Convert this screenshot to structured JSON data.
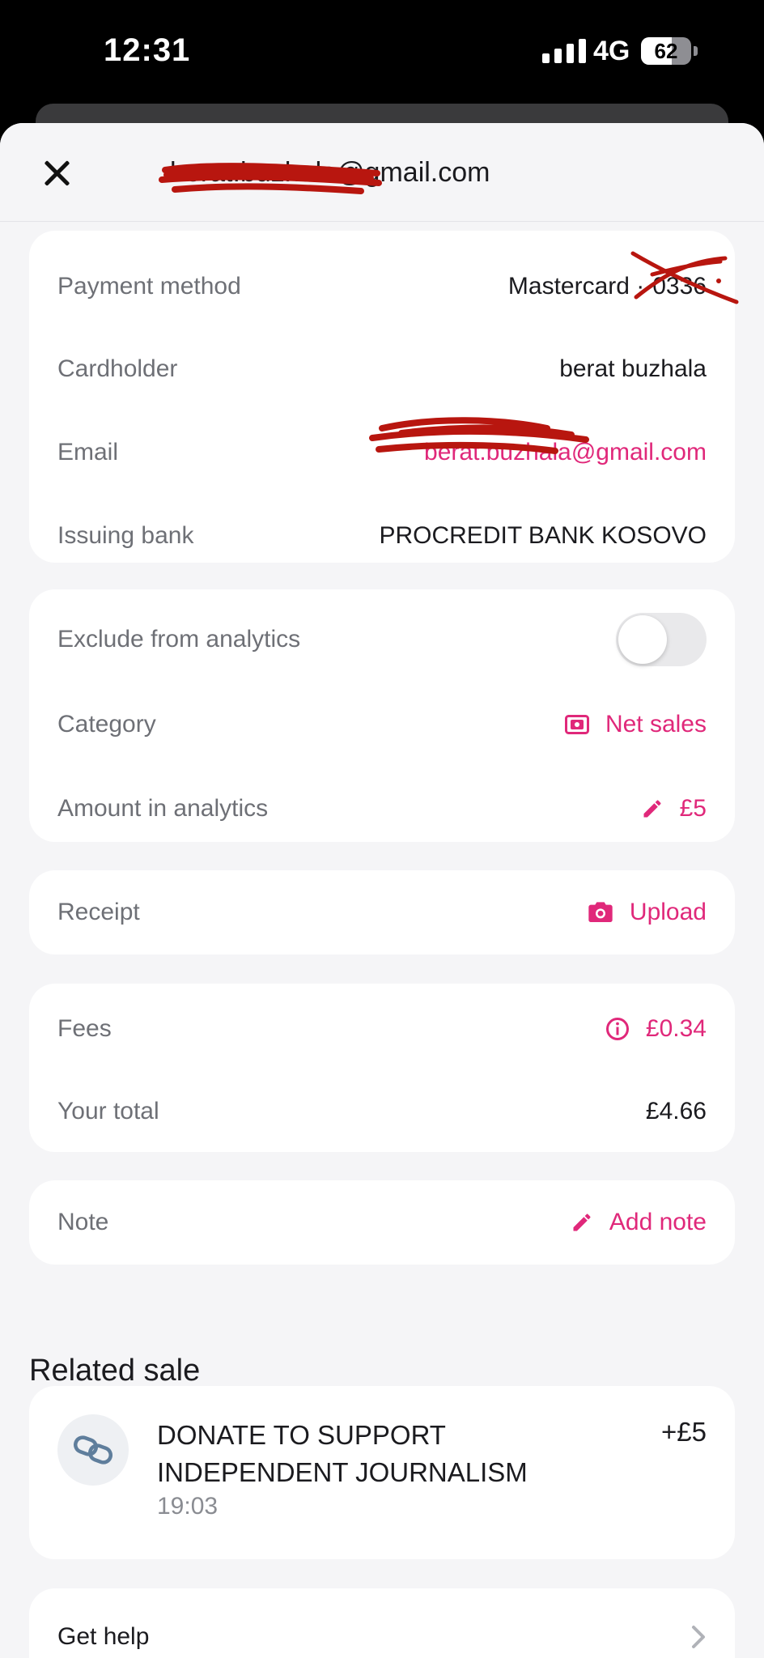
{
  "status_bar": {
    "time": "12:31",
    "network": "4G",
    "battery": "62",
    "battery_level": 0.62
  },
  "header": {
    "title": "berat.buzhala@gmail.com"
  },
  "details": {
    "payment_method_label": "Payment method",
    "payment_method_value": "Mastercard ··0336",
    "cardholder_label": "Cardholder",
    "cardholder_value": "berat buzhala",
    "email_label": "Email",
    "email_value": "berat.buzhala@gmail.com",
    "issuing_bank_label": "Issuing bank",
    "issuing_bank_value": "PROCREDIT BANK KOSOVO"
  },
  "analytics": {
    "exclude_label": "Exclude from analytics",
    "exclude_on": false,
    "category_label": "Category",
    "category_value": "Net sales",
    "amount_label": "Amount in analytics",
    "amount_value": "£5"
  },
  "receipt": {
    "label": "Receipt",
    "action": "Upload"
  },
  "fees": {
    "fees_label": "Fees",
    "fees_value": "£0.34",
    "total_label": "Your total",
    "total_value": "£4.66"
  },
  "note": {
    "label": "Note",
    "action": "Add note"
  },
  "related_sale": {
    "section_title": "Related sale",
    "title": "DONATE TO SUPPORT INDEPENDENT JOURNALISM",
    "time": "19:03",
    "amount": "+£5"
  },
  "help": {
    "label": "Get help"
  },
  "colors": {
    "accent": "#e0287a",
    "redaction": "#b8160f",
    "label": "#6e7076"
  },
  "icons": [
    "close-icon",
    "banknote-icon",
    "pencil-icon",
    "camera-icon",
    "info-icon",
    "link-icon",
    "chevron-right-icon"
  ]
}
